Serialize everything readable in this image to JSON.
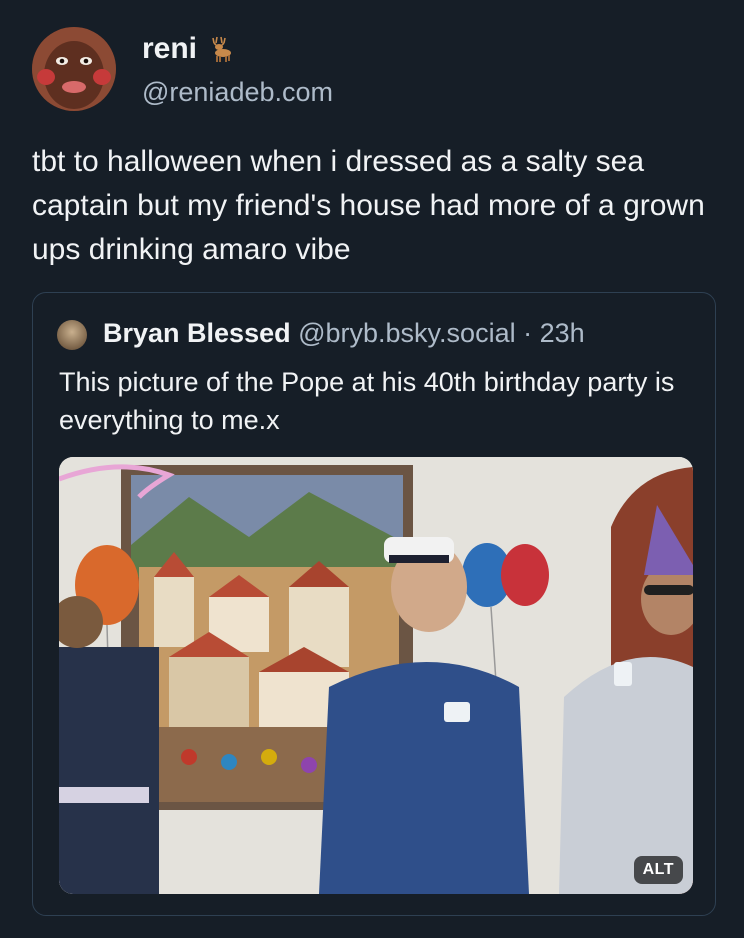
{
  "author": {
    "display_name": "reni",
    "emoji_icon": "deer-icon",
    "handle": "@reniadeb.com"
  },
  "post": {
    "text": "tbt to halloween when i dressed as a salty sea captain but my friend's house had more of a grown ups drinking amaro vibe"
  },
  "quoted_post": {
    "display_name": "Bryan Blessed",
    "handle": "@bryb.bsky.social",
    "separator": "·",
    "time": "23h",
    "text": "This picture of the Pope at his 40th birthday party is everything to me.x",
    "image": {
      "alt_label": "ALT"
    }
  },
  "colors": {
    "background": "#161e27",
    "text_primary": "#f1f3f5",
    "text_secondary": "#aebbc9",
    "border": "#2e4052"
  }
}
